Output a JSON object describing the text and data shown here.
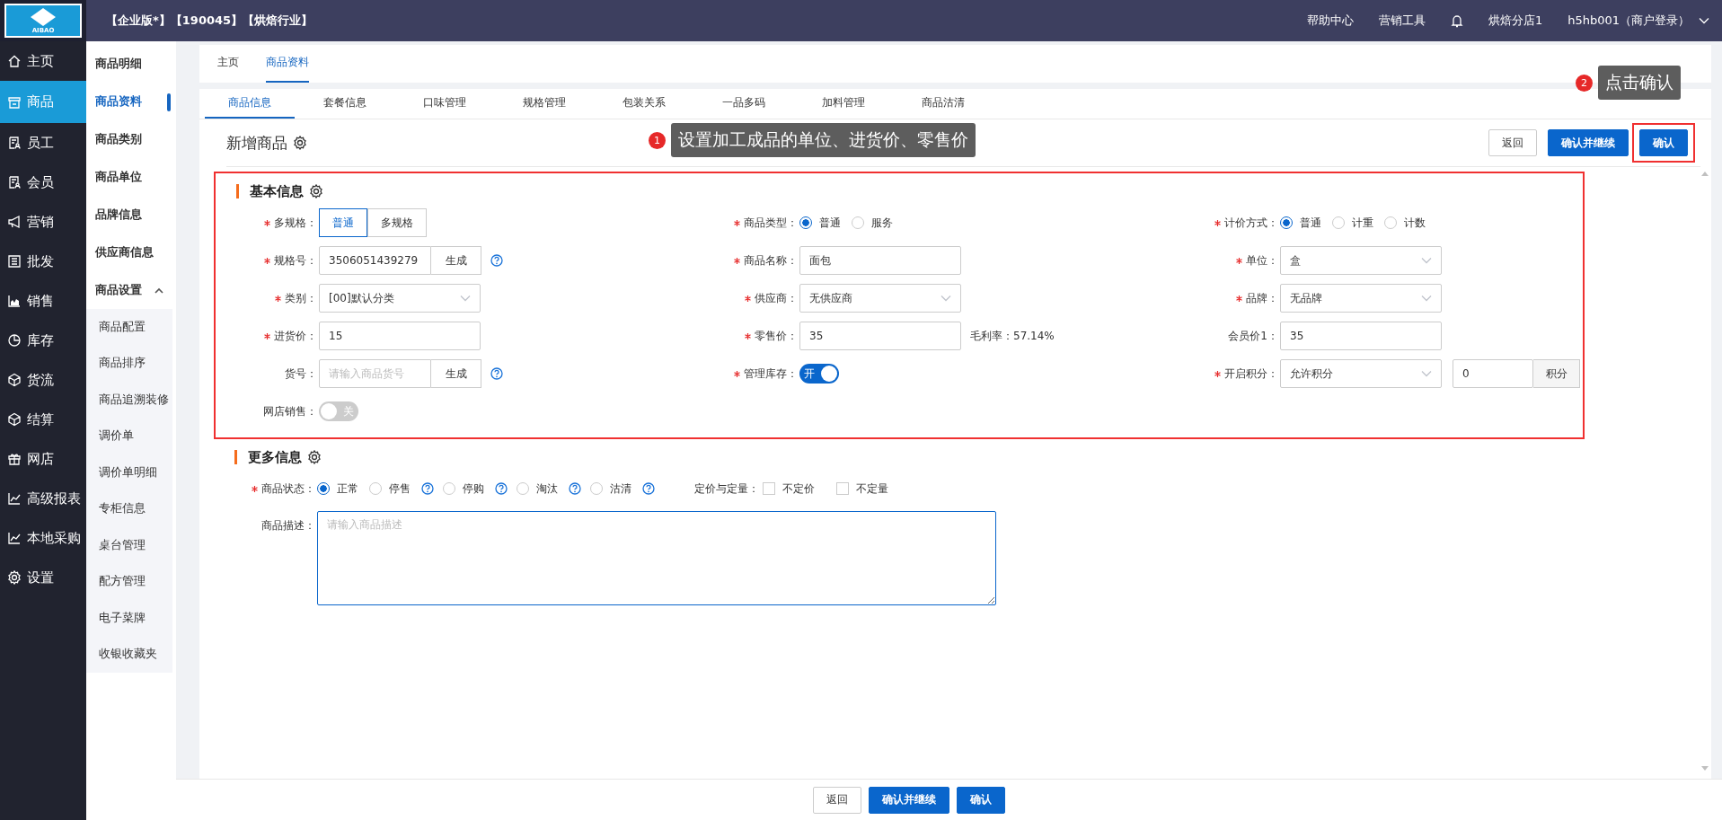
{
  "header": {
    "logo_text": "AIBAO",
    "tags": [
      "【企业版*】",
      "【190045】",
      "【烘焙行业】"
    ],
    "links": [
      "帮助中心",
      "营销工具"
    ],
    "store": "烘焙分店1",
    "user": "h5hb001（商户登录）"
  },
  "nav": [
    {
      "label": "主页",
      "selected": false
    },
    {
      "label": "商品",
      "selected": true
    },
    {
      "label": "员工",
      "selected": false
    },
    {
      "label": "会员",
      "selected": false
    },
    {
      "label": "营销",
      "selected": false
    },
    {
      "label": "批发",
      "selected": false
    },
    {
      "label": "销售",
      "selected": false
    },
    {
      "label": "库存",
      "selected": false
    },
    {
      "label": "货流",
      "selected": false
    },
    {
      "label": "结算",
      "selected": false
    },
    {
      "label": "网店",
      "selected": false
    },
    {
      "label": "高级报表",
      "selected": false
    },
    {
      "label": "本地采购",
      "selected": false
    },
    {
      "label": "设置",
      "selected": false
    }
  ],
  "subnav": [
    {
      "label": "商品明细",
      "selected": false
    },
    {
      "label": "商品资料",
      "selected": true
    },
    {
      "label": "商品类别",
      "selected": false
    },
    {
      "label": "商品单位",
      "selected": false
    },
    {
      "label": "品牌信息",
      "selected": false
    },
    {
      "label": "供应商信息",
      "selected": false
    },
    {
      "label": "商品设置",
      "selected": false,
      "expanded": true,
      "children": [
        {
          "label": "商品配置"
        },
        {
          "label": "商品排序"
        },
        {
          "label": "商品追溯装修"
        },
        {
          "label": "调价单"
        },
        {
          "label": "调价单明细"
        },
        {
          "label": "专柜信息"
        },
        {
          "label": "桌台管理"
        },
        {
          "label": "配方管理"
        },
        {
          "label": "电子菜牌"
        },
        {
          "label": "收银收藏夹"
        }
      ]
    }
  ],
  "page_tabs": [
    {
      "label": "主页",
      "selected": false
    },
    {
      "label": "商品资料",
      "selected": true
    }
  ],
  "sub_tabs": [
    {
      "label": "商品信息",
      "selected": true
    },
    {
      "label": "套餐信息",
      "selected": false
    },
    {
      "label": "口味管理",
      "selected": false
    },
    {
      "label": "规格管理",
      "selected": false
    },
    {
      "label": "包装关系",
      "selected": false
    },
    {
      "label": "一品多码",
      "selected": false
    },
    {
      "label": "加料管理",
      "selected": false
    },
    {
      "label": "商品沽清",
      "selected": false
    }
  ],
  "title": "新增商品",
  "top_buttons": [
    {
      "label": "返回",
      "kind": "default",
      "highlighted": false
    },
    {
      "label": "确认并继续",
      "kind": "primary",
      "highlighted": false
    },
    {
      "label": "确认",
      "kind": "primary",
      "highlighted": true
    }
  ],
  "annotations": [
    {
      "number": "1",
      "text": "设置加工成品的单位、进货价、零售价"
    },
    {
      "number": "2",
      "text": "点击确认"
    }
  ],
  "basic_info": {
    "title": "基本信息",
    "highlighted": true,
    "fields": [
      {
        "label": "多规格：",
        "required": true,
        "kind": "segmented",
        "options": [
          {
            "label": "普通",
            "selected": true
          },
          {
            "label": "多规格",
            "selected": false
          }
        ]
      },
      {
        "label": "商品类型：",
        "required": true,
        "kind": "radio",
        "options": [
          {
            "label": "普通",
            "selected": true
          },
          {
            "label": "服务",
            "selected": false
          }
        ]
      },
      {
        "label": "计价方式：",
        "required": true,
        "kind": "radio",
        "options": [
          {
            "label": "普通",
            "selected": true
          },
          {
            "label": "计重",
            "selected": false
          },
          {
            "label": "计数",
            "selected": false
          }
        ]
      },
      {
        "label": "规格号：",
        "required": true,
        "kind": "input",
        "value": "3506051439279",
        "button": "生成",
        "help": true
      },
      {
        "label": "商品名称：",
        "required": true,
        "kind": "input",
        "value": "面包"
      },
      {
        "label": "单位：",
        "required": true,
        "kind": "select",
        "value": "盒"
      },
      {
        "label": "类别：",
        "required": true,
        "kind": "select",
        "value": "[00]默认分类"
      },
      {
        "label": "供应商：",
        "required": true,
        "kind": "select",
        "value": "无供应商"
      },
      {
        "label": "品牌：",
        "required": true,
        "kind": "select",
        "value": "无品牌"
      },
      {
        "label": "进货价：",
        "required": true,
        "kind": "input",
        "value": "15"
      },
      {
        "label": "零售价：",
        "required": true,
        "kind": "input",
        "value": "35",
        "suffix": "毛利率：57.14%"
      },
      {
        "label": "会员价1：",
        "required": false,
        "kind": "input",
        "value": "35"
      },
      {
        "label": "货号：",
        "required": false,
        "kind": "input",
        "placeholder": "请输入商品货号",
        "button": "生成",
        "help": true
      },
      {
        "label": "管理库存：",
        "required": true,
        "kind": "switch",
        "on": true,
        "text": "开"
      },
      {
        "label": "开启积分：",
        "required": true,
        "kind": "points",
        "value": "允许积分",
        "amount": "0",
        "button": "积分"
      },
      {
        "label": "网店销售：",
        "required": false,
        "kind": "switch",
        "on": false,
        "text": "关"
      }
    ]
  },
  "more_info": {
    "title": "更多信息",
    "status": {
      "label": "商品状态：",
      "required": true,
      "options": [
        {
          "label": "正常",
          "selected": true,
          "help": false
        },
        {
          "label": "停售",
          "selected": false,
          "help": true
        },
        {
          "label": "停购",
          "selected": false,
          "help": true
        },
        {
          "label": "淘汰",
          "selected": false,
          "help": true
        },
        {
          "label": "沽清",
          "selected": false,
          "help": true
        }
      ]
    },
    "pricing": {
      "label": "定价与定量：",
      "options": [
        {
          "label": "不定价",
          "checked": false
        },
        {
          "label": "不定量",
          "checked": false
        }
      ]
    },
    "description": {
      "label": "商品描述：",
      "placeholder": "请输入商品描述"
    }
  },
  "bottom_buttons": [
    {
      "label": "返回",
      "kind": "default"
    },
    {
      "label": "确认并继续",
      "kind": "primary"
    },
    {
      "label": "确认",
      "kind": "primary"
    }
  ]
}
